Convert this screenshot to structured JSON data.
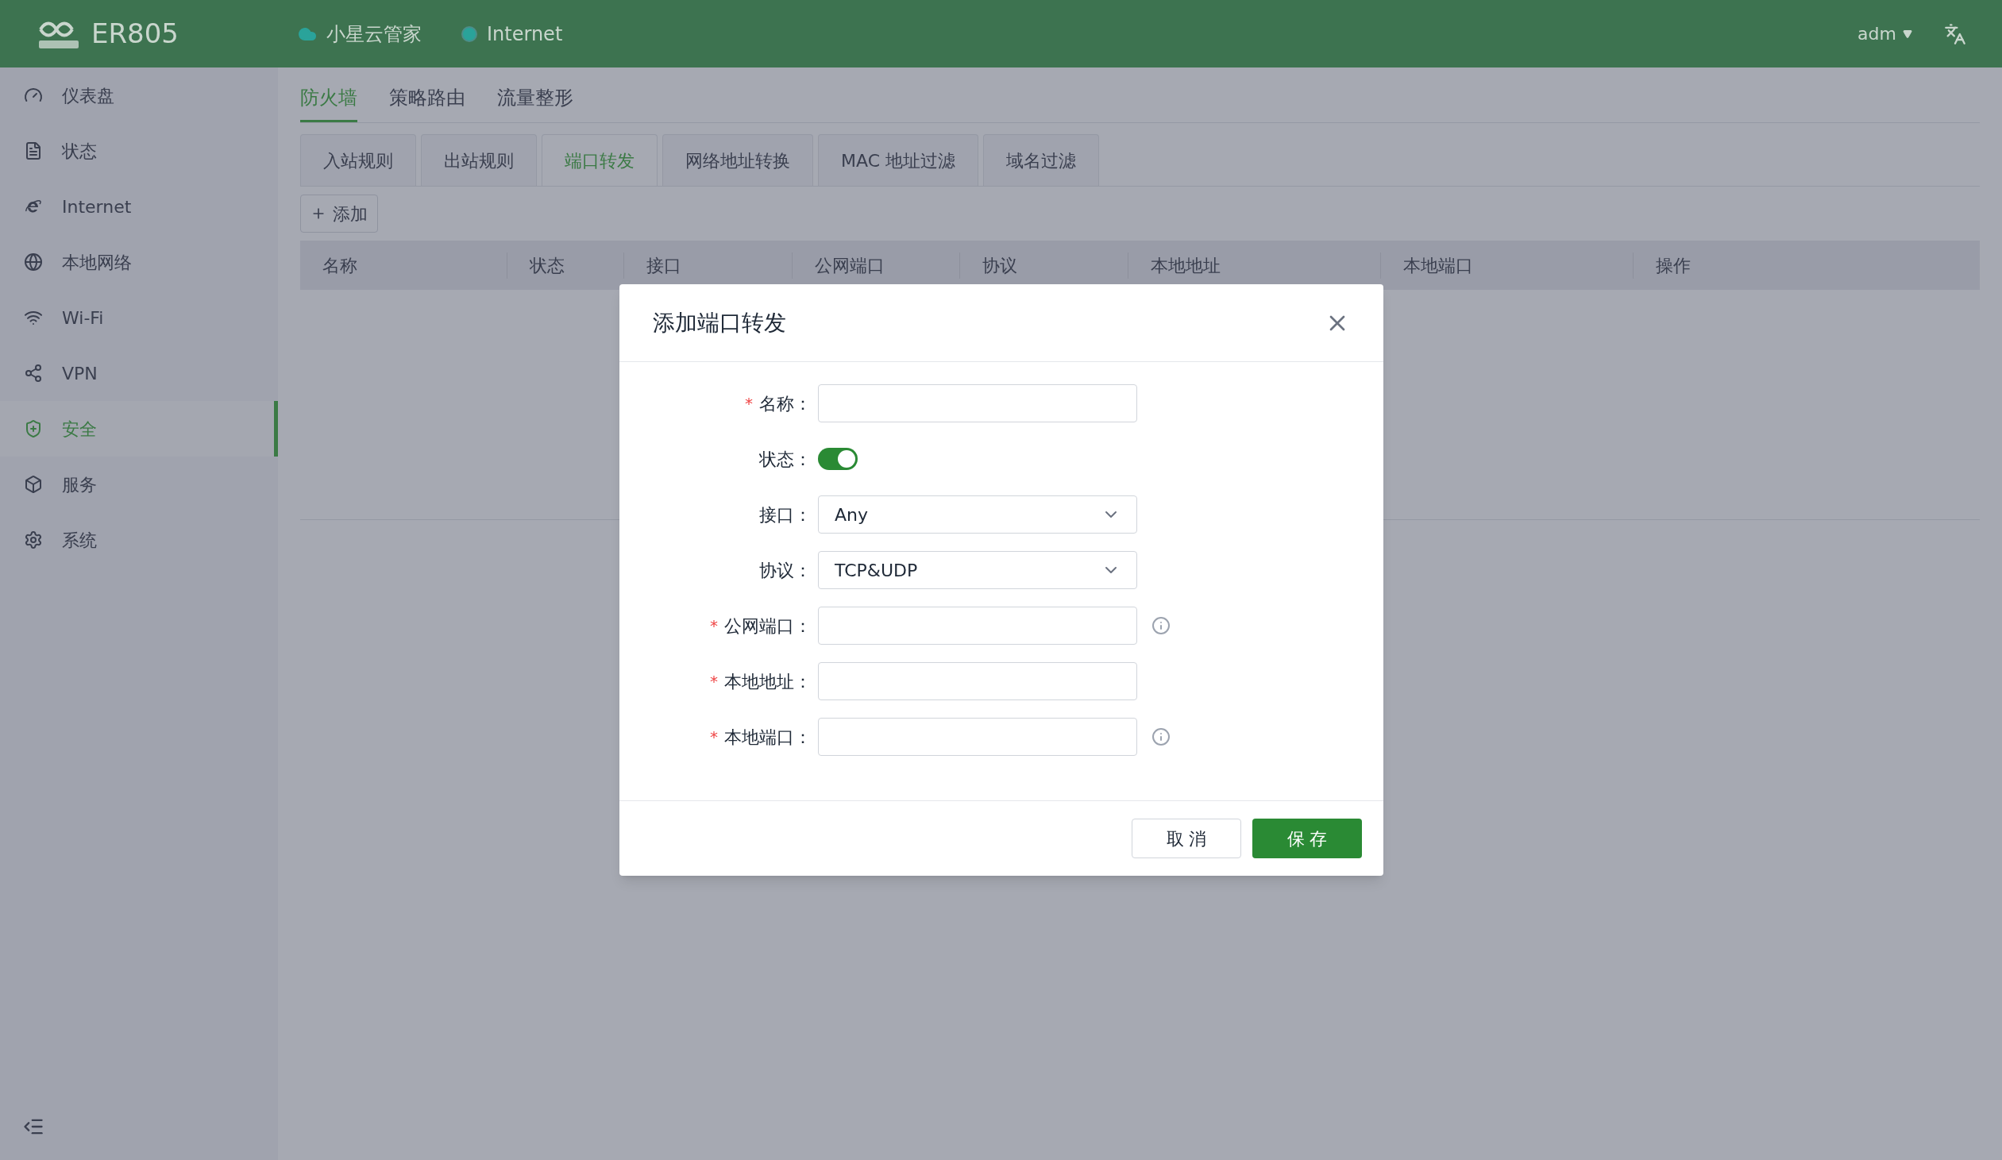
{
  "header": {
    "product": "ER805",
    "links": [
      {
        "label": "小星云管家",
        "kind": "cloud"
      },
      {
        "label": "Internet",
        "kind": "dot"
      }
    ],
    "user": "adm"
  },
  "sidebar": {
    "items": [
      {
        "label": "仪表盘",
        "selected": false
      },
      {
        "label": "状态",
        "selected": false
      },
      {
        "label": "Internet",
        "selected": false
      },
      {
        "label": "本地网络",
        "selected": false
      },
      {
        "label": "Wi-Fi",
        "selected": false
      },
      {
        "label": "VPN",
        "selected": false
      },
      {
        "label": "安全",
        "selected": true
      },
      {
        "label": "服务",
        "selected": false
      },
      {
        "label": "系统",
        "selected": false
      }
    ]
  },
  "tabs": [
    {
      "label": "防火墙",
      "selected": true
    },
    {
      "label": "策略路由",
      "selected": false
    },
    {
      "label": "流量整形",
      "selected": false
    }
  ],
  "subtabs": [
    {
      "label": "入站规则",
      "selected": false
    },
    {
      "label": "出站规则",
      "selected": false
    },
    {
      "label": "端口转发",
      "selected": true
    },
    {
      "label": "网络地址转换",
      "selected": false
    },
    {
      "label": "MAC 地址过滤",
      "selected": false
    },
    {
      "label": "域名过滤",
      "selected": false
    }
  ],
  "add_button": "添加",
  "table": {
    "columns": [
      "名称",
      "状态",
      "接口",
      "公网端口",
      "协议",
      "本地地址",
      "本地端口",
      "操作"
    ]
  },
  "dialog": {
    "title": "添加端口转发",
    "fields": [
      {
        "required_mark": "*",
        "label": "名称：",
        "kind": "text",
        "info": false
      },
      {
        "label": "状态：",
        "kind": "switch",
        "on": true
      },
      {
        "label": "接口：",
        "kind": "select",
        "value": "Any"
      },
      {
        "label": "协议：",
        "kind": "select",
        "value": "TCP&UDP"
      },
      {
        "required_mark": "*",
        "label": "公网端口：",
        "kind": "text",
        "info": true
      },
      {
        "required_mark": "*",
        "label": "本地地址：",
        "kind": "text",
        "info": false
      },
      {
        "required_mark": "*",
        "label": "本地端口：",
        "kind": "text",
        "info": true
      }
    ],
    "buttons": [
      {
        "label": "取 消",
        "kind": "secondary"
      },
      {
        "label": "保 存",
        "kind": "primary"
      }
    ]
  }
}
